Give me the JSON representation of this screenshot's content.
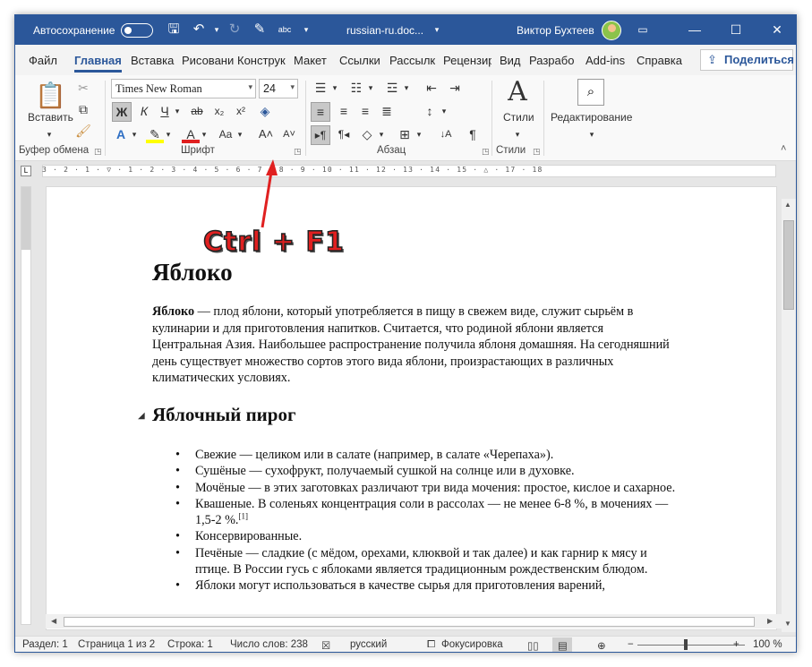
{
  "titlebar": {
    "autosave_label": "Автосохранение",
    "doc_name": "russian-ru.doc...",
    "user_name": "Виктор Бухтеев",
    "minimize": "—",
    "maximize": "☐",
    "close": "✕"
  },
  "tabs": [
    {
      "label": "Файл"
    },
    {
      "label": "Главная"
    },
    {
      "label": "Вставка"
    },
    {
      "label": "Рисовани"
    },
    {
      "label": "Конструк"
    },
    {
      "label": "Макет"
    },
    {
      "label": "Ссылки"
    },
    {
      "label": "Рассылк"
    },
    {
      "label": "Рецензир"
    },
    {
      "label": "Вид"
    },
    {
      "label": "Разрабо"
    },
    {
      "label": "Add-ins"
    },
    {
      "label": "Справка"
    }
  ],
  "share_label": "Поделиться",
  "ribbon": {
    "paste_label": "Вставить",
    "clipboard_group": "Буфер обмена",
    "font_group": "Шрифт",
    "paragraph_group": "Абзац",
    "styles_group": "Стили",
    "styles_label": "Стили",
    "editing_label": "Редактирование",
    "font_name": "Times New Roman",
    "font_size": "24",
    "bold": "Ж",
    "italic": "К",
    "underline": "Ч",
    "strike": "ab",
    "subscript": "x₂",
    "superscript": "x²",
    "change_case": "Aa",
    "grow_font": "A˄",
    "shrink_font": "A˅",
    "pilcrow": "¶"
  },
  "ruler": {
    "marks": "3 · 2 · 1 · ▽ · 1 · 2 · 3 · 4 · 5 · 6 · 7 · 8 · 9 · 10 · 11 · 12 · 13 · 14 · 15 · △ · 17 · 18"
  },
  "document": {
    "title": "Яблоко",
    "para_bold": "Яблоко",
    "para_rest": " — плод яблони, который употребляется в пищу в свежем виде, служит сырьём в кулинарии и для приготовления напитков. Считается, что родиной яблони является Центральная Азия. Наибольшее распространение получила яблоня домашняя. На сегодняшний день существует множество сортов этого вида яблони, произрастающих в различных климатических условиях.",
    "heading2": "Яблочный пирог",
    "list": [
      "Свежие — целиком или в салате (например, в салате «Черепаха»).",
      "Сушёные — сухофрукт, получаемый сушкой на солнце или в духовке.",
      "Мочёные — в этих заготовках различают три вида мочения: простое, кислое и сахарное.",
      "Квашеные. В соленьях концентрация соли в рассолах — не менее 6-8 %, в мочениях — 1,5-2 %.",
      "Консервированные.",
      "Печёные — сладкие (с мёдом, орехами, клюквой и так далее) и как гарнир к мясу и птице. В России гусь с яблоками является традиционным рождественским блюдом.",
      "Яблоки могут использоваться в качестве сырья для приготовления варений,"
    ],
    "footnote": "[1]"
  },
  "annotation": "Ctrl + F1",
  "status": {
    "section": "Раздел: 1",
    "page": "Страница 1 из 2",
    "line": "Строка: 1",
    "words": "Число слов: 238",
    "language": "русский",
    "focus": "Фокусировка",
    "zoom_minus": "−",
    "zoom_plus": "+",
    "zoom": "100 %"
  },
  "colors": {
    "brand": "#2b579a",
    "annotation": "#e02020"
  }
}
